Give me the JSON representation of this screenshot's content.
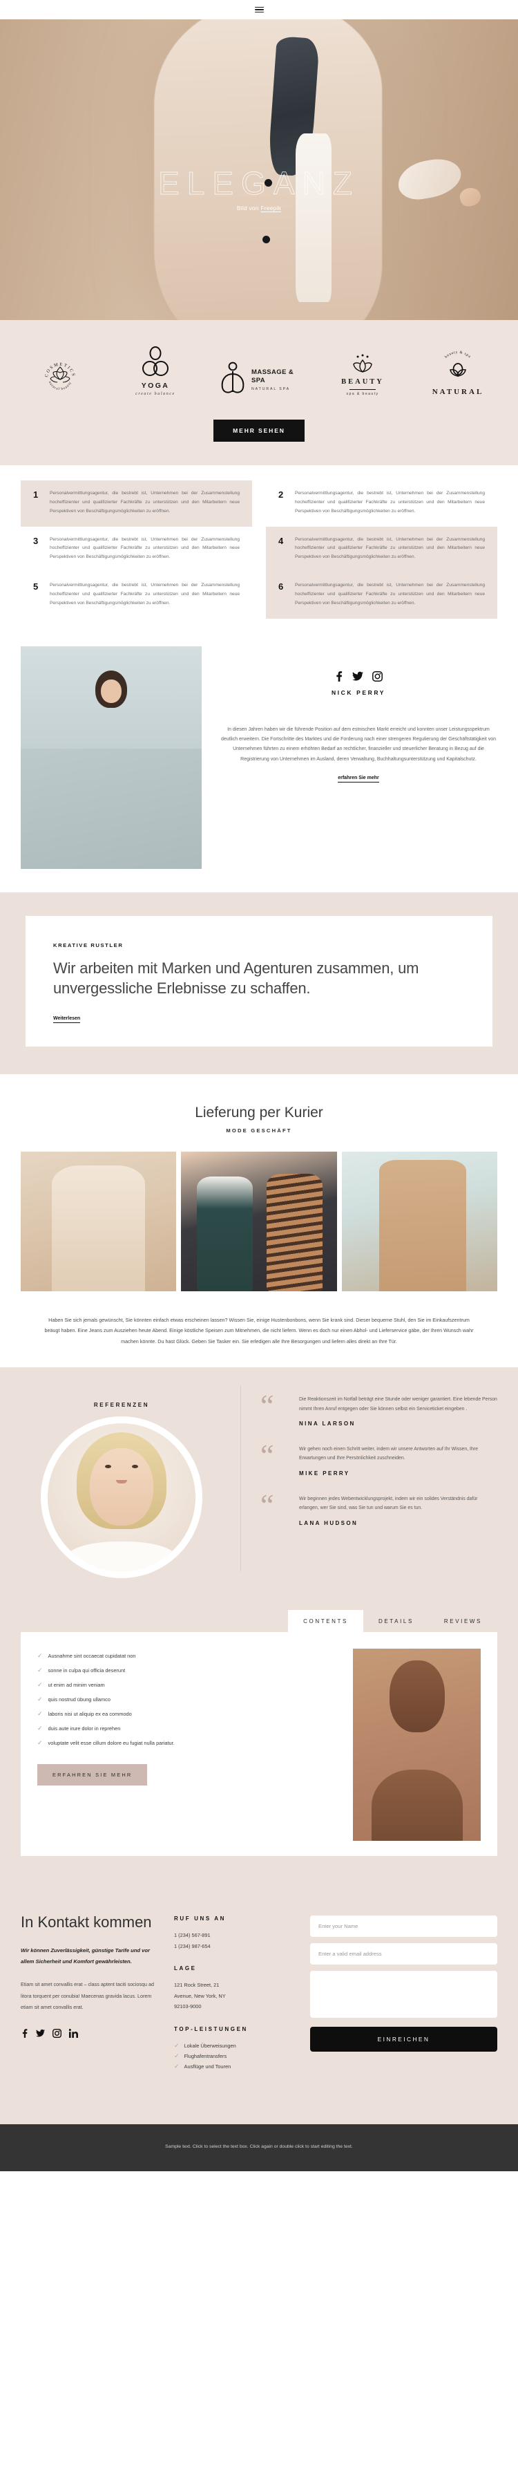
{
  "header": {
    "menu_icon": "hamburger-icon"
  },
  "hero": {
    "title": "ELEGANZ",
    "credit_prefix": "Bild von ",
    "credit_link": "Freepik"
  },
  "brands": {
    "items": [
      {
        "name": "COSMETICS",
        "tagline": "natural beauty",
        "icon": "lotus-circle-icon"
      },
      {
        "name": "YOGA",
        "tagline": "create balance",
        "icon": "yoga-infinity-icon"
      },
      {
        "name": "MASSAGE & SPA",
        "tagline": "NATURAL SPA",
        "icon": "massage-figure-icon"
      },
      {
        "name": "BEAUTY",
        "tagline": "spa & beauty",
        "icon": "lotus-crown-icon"
      },
      {
        "name": "NATURAL",
        "tagline": "beauty & spa",
        "icon": "leaf-sprout-icon"
      }
    ],
    "cta": "MEHR SEHEN"
  },
  "features": {
    "body": "Personalvermittlungsagentur, die bestrebt ist, Unternehmen bei der Zusammenstellung hocheffizienter und qualifizierter Fachkräfte zu unterstützen und den Mitarbeitern neue Perspektiven von Beschäftigungsmöglichkeiten zu eröffnen.",
    "items": [
      {
        "number": "1",
        "highlight": true
      },
      {
        "number": "2",
        "highlight": false
      },
      {
        "number": "3",
        "highlight": false
      },
      {
        "number": "4",
        "highlight": true
      },
      {
        "number": "5",
        "highlight": false
      },
      {
        "number": "6",
        "highlight": true
      }
    ]
  },
  "bio": {
    "name": "NICK PERRY",
    "socials": [
      "facebook-icon",
      "twitter-icon",
      "instagram-icon"
    ],
    "text": "In diesen Jahren haben wir die führende Position auf dem estnischen Markt erreicht und konnten unser Leistungsspektrum deutlich erweitern. Die Fortschritte des Marktes und die Forderung nach einer strengeren Regulierung der Geschäftstätigkeit von Unternehmen führten zu einem erhöhten Bedarf an rechtlicher, finanzieller und steuerlicher Beratung in Bezug auf die Registrierung von Unternehmen im Ausland, deren Verwaltung, Buchhaltungsunterstützung und Kapitalschutz.",
    "link": "erfahren Sie mehr"
  },
  "creative": {
    "kicker": "KREATIVE RUSTLER",
    "heading": "Wir arbeiten mit Marken und Agenturen zusammen, um unvergessliche Erlebnisse zu schaffen.",
    "link": "Weiterlesen"
  },
  "delivery": {
    "title": "Lieferung per Kurier",
    "subtitle": "MODE GESCHÄFT",
    "paragraph": "Haben Sie sich jemals gewünscht, Sie könnten einfach etwas erscheinen lassen? Wissen Sie, einige Hustenbonbons, wenn Sie krank sind. Dieser bequeme Stuhl, den Sie im Einkaufszentrum beäugt haben. Eine Jeans zum Ausziehen heute Abend. Einige köstliche Speisen zum Mitnehmen, die nicht liefern. Wenn es doch nur einen Abhol- und Lieferservice gäbe, der Ihren Wunsch wahr machen könnte. Du hast Glück. Geben Sie Tasker ein. Sie erledigen alle Ihre Besorgungen und liefern alles direkt an Ihre Tür."
  },
  "references": {
    "title": "REFERENZEN",
    "quotes": [
      {
        "text": "Die Reaktionszeit im Notfall beträgt eine Stunde oder weniger garantiert. Eine lebende Person nimmt Ihren Anruf entgegen oder Sie können selbst ein Serviceticket eingeben .",
        "author": "NINA LARSON"
      },
      {
        "text": "Wir gehen noch einen Schritt weiter, indem wir unsere Antworten auf Ihr Wissen, Ihre Erwartungen und Ihre Persönlichkeit zuschneiden.",
        "author": "MIKE PERRY"
      },
      {
        "text": "Wir beginnen jedes Webentwicklungsprojekt, indem wir ein solides Verständnis dafür erlangen, wer Sie sind, was Sie tun und warum Sie es tun.",
        "author": "LANA HUDSON"
      }
    ]
  },
  "tabs": {
    "items": [
      {
        "label": "CONTENTS",
        "active": true
      },
      {
        "label": "DETAILS",
        "active": false
      },
      {
        "label": "REVIEWS",
        "active": false
      }
    ],
    "checklist": [
      "Ausnahme sint occaecat cupidatat non",
      "sonne in culpa qui officia deserunt",
      "ut enim ad minim veniam",
      "quis nostrud übung ullamco",
      "laboris nisi ut aliquip ex ea commodo",
      "duis aute irure dolor in reprehen",
      "voluptate velit esse cillum dolore eu fugiat nulla pariatur."
    ],
    "cta": "ERFAHREN SIE MEHR",
    "check_icon": "check-icon"
  },
  "contact": {
    "heading": "In Kontakt kommen",
    "lead": "Wir können Zuverlässigkeit, günstige Tarife und vor allem Sicherheit und Komfort gewährleisten.",
    "body": "Etiam sit amet convallis erat – class aptent taciti sociosqu ad litora torquent per conubia! Maecenas gravida lacus. Lorem etiam sit amet convallis erat.",
    "socials": [
      "facebook-icon",
      "twitter-icon",
      "instagram-icon",
      "linkedin-icon"
    ],
    "call_title": "RUF UNS AN",
    "phone1": "1 (234) 567-891",
    "phone2": "1 (234) 987-654",
    "location_title": "LAGE",
    "address1": "121 Rock Street, 21",
    "address2": "Avenue, New York, NY",
    "address3": "92103-9000",
    "services_title": "TOP-LEISTUNGEN",
    "services": [
      "Lokale Überweisungen",
      "Flughafentransfers",
      "Ausflüge und Touren"
    ],
    "form": {
      "name_placeholder": "Enter your Name",
      "email_placeholder": "Enter a valid email address",
      "message_placeholder": "",
      "submit": "EINREICHEN"
    }
  },
  "footer": {
    "text": "Sample text. Click to select the text box. Click again or double click to start editing the text."
  },
  "colors": {
    "band": "#ece0da",
    "dark": "#121212",
    "accent": "#cdb9b2",
    "footer": "#343434"
  }
}
